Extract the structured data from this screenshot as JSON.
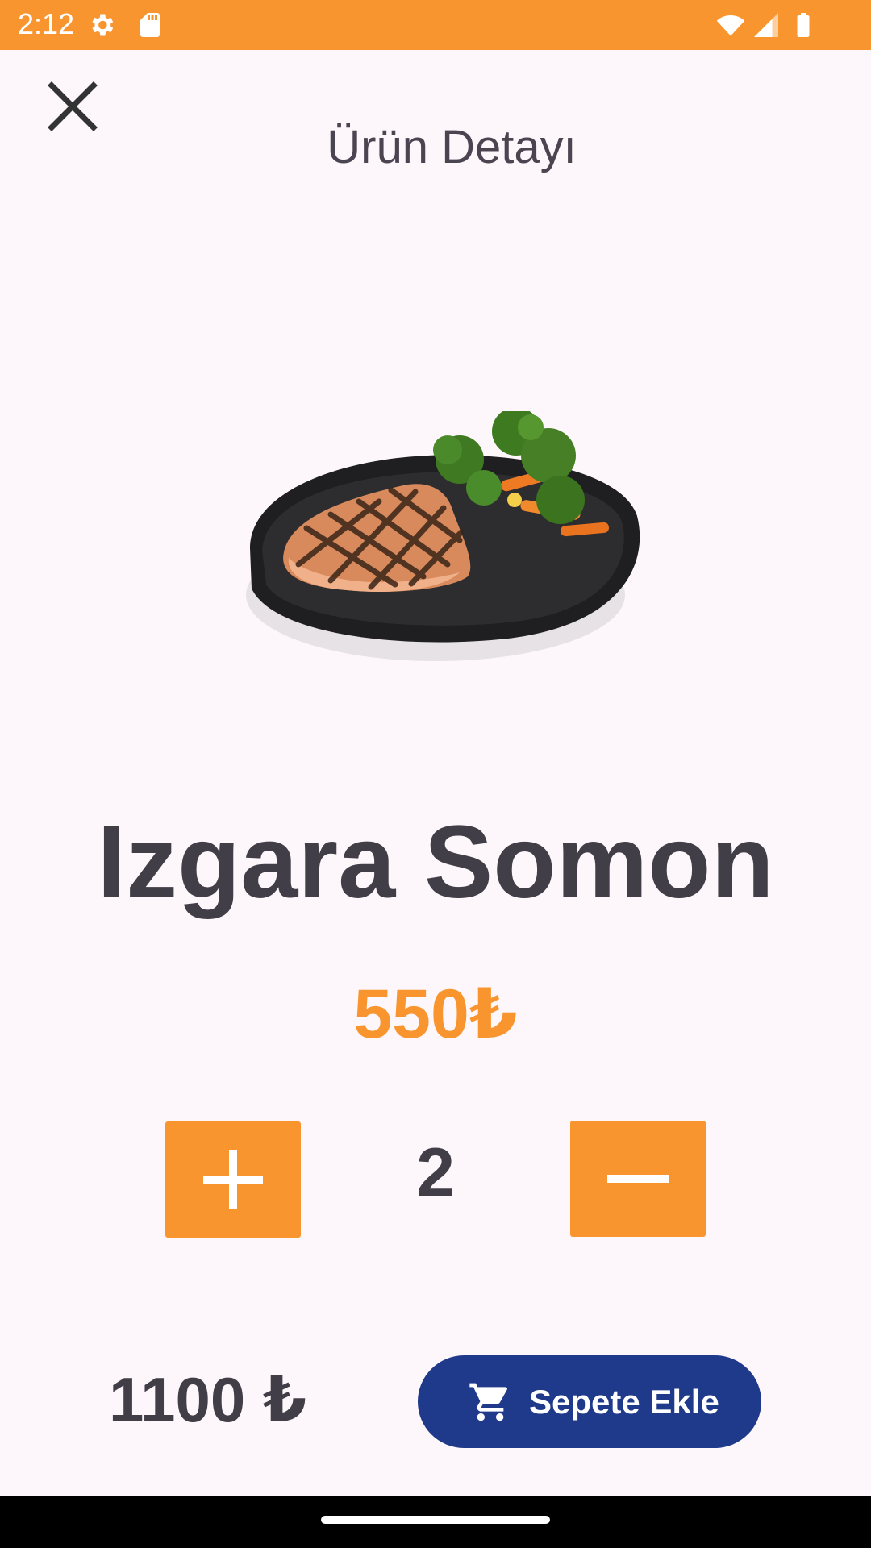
{
  "colors": {
    "accent": "#f9952e",
    "primary_button": "#1f3a8a",
    "text_dark": "#413e48",
    "background": "#fdf7fb"
  },
  "status_bar": {
    "time": "2:12",
    "icons": [
      "gear-icon",
      "sd-card-icon",
      "wifi-icon",
      "signal-icon",
      "battery-icon"
    ]
  },
  "header": {
    "close_icon": "close-icon",
    "title": "Ürün Detayı"
  },
  "product": {
    "image_description_icon": "grilled-salmon-image",
    "name": "Izgara Somon",
    "price": "550₺"
  },
  "quantity": {
    "plus_icon": "plus-icon",
    "value": "2",
    "minus_icon": "minus-icon"
  },
  "footer": {
    "total": "1100 ₺",
    "cart_icon": "cart-icon",
    "add_to_cart_label": "Sepete Ekle"
  }
}
